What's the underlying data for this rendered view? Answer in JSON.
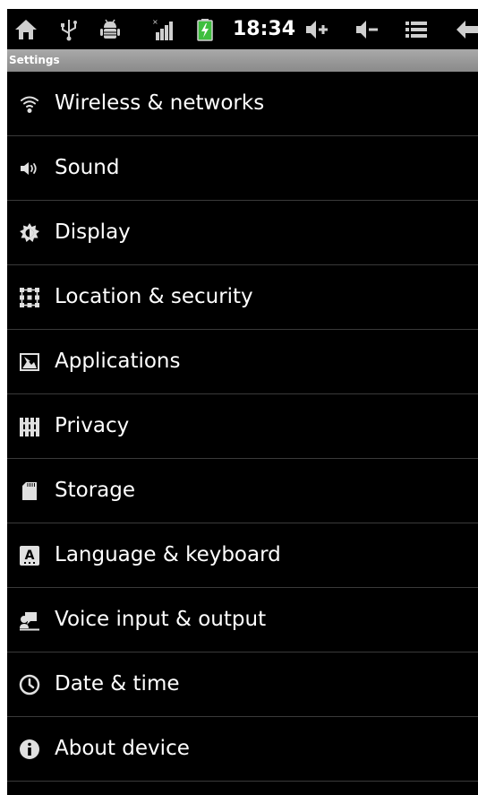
{
  "status_bar": {
    "time": "18:34",
    "icons": [
      "home-icon",
      "usb-icon",
      "android-debug-icon",
      "signal-icon",
      "battery-charging-icon",
      "volume-up-icon",
      "volume-down-icon",
      "menu-icon",
      "back-icon"
    ]
  },
  "header": {
    "title": "Settings"
  },
  "settings": {
    "items": [
      {
        "label": "Wireless & networks",
        "icon": "wifi-icon"
      },
      {
        "label": "Sound",
        "icon": "speaker-icon"
      },
      {
        "label": "Display",
        "icon": "brightness-icon"
      },
      {
        "label": "Location & security",
        "icon": "grid-lock-icon"
      },
      {
        "label": "Applications",
        "icon": "applications-icon"
      },
      {
        "label": "Privacy",
        "icon": "fence-icon"
      },
      {
        "label": "Storage",
        "icon": "sd-card-icon"
      },
      {
        "label": "Language & keyboard",
        "icon": "keyboard-a-icon"
      },
      {
        "label": "Voice input & output",
        "icon": "voice-icon"
      },
      {
        "label": "Date & time",
        "icon": "clock-icon"
      },
      {
        "label": "About device",
        "icon": "info-icon"
      }
    ]
  },
  "colors": {
    "background": "#000000",
    "titlebar": "#9a9a9a",
    "text": "#ffffff",
    "divider": "#3a3a3a"
  }
}
